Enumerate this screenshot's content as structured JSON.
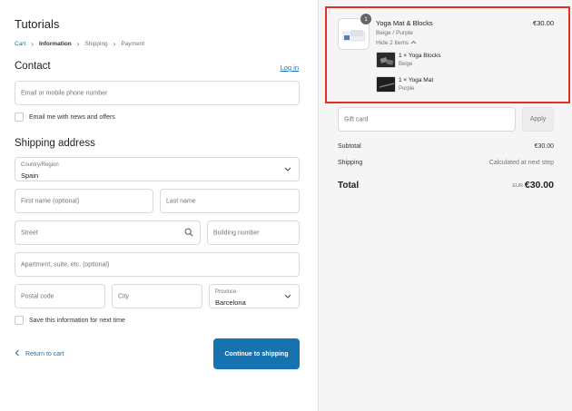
{
  "store": {
    "title": "Tutorials"
  },
  "breadcrumb": [
    "Cart",
    "Information",
    "Shipping",
    "Payment"
  ],
  "contact": {
    "title": "Contact",
    "login_label": "Log in",
    "email_placeholder": "Email or mobile phone number",
    "newsletter_label": "Email me with news and offers"
  },
  "shipping": {
    "title": "Shipping address",
    "country_label": "Country/Region",
    "country_value": "Spain",
    "first_name_placeholder": "First name (optional)",
    "last_name_placeholder": "Last name",
    "street_placeholder": "Street",
    "building_placeholder": "Building number",
    "apartment_placeholder": "Apartment, suite, etc. (optional)",
    "postal_placeholder": "Postal code",
    "city_placeholder": "City",
    "province_label": "Province",
    "province_value": "Barcelona",
    "save_label": "Save this information for next time"
  },
  "actions": {
    "return_label": "Return to cart",
    "continue_label": "Continue to shipping"
  },
  "order": {
    "product_name": "Yoga Mat & Blocks",
    "product_variant": "Beige / Purple",
    "product_price": "€30.00",
    "quantity": "1",
    "hide_items_label": "Hide 2 items",
    "sub_items": [
      {
        "name": "1 × Yoga Blocks",
        "variant": "Beige"
      },
      {
        "name": "1 × Yoga Mat",
        "variant": "Purple"
      }
    ]
  },
  "gift_card": {
    "placeholder": "Gift card",
    "apply_label": "Apply"
  },
  "summary": {
    "subtotal_label": "Subtotal",
    "subtotal_value": "€30.00",
    "shipping_label": "Shipping",
    "shipping_value": "Calculated at next step",
    "total_label": "Total",
    "total_currency": "EUR",
    "total_value": "€30.00"
  },
  "colors": {
    "accent": "#1773b0",
    "highlight": "#e0321e"
  },
  "icons": [
    "chevron-right-icon",
    "chevron-down-icon",
    "search-icon",
    "chevron-left-icon",
    "chevron-up-icon"
  ]
}
